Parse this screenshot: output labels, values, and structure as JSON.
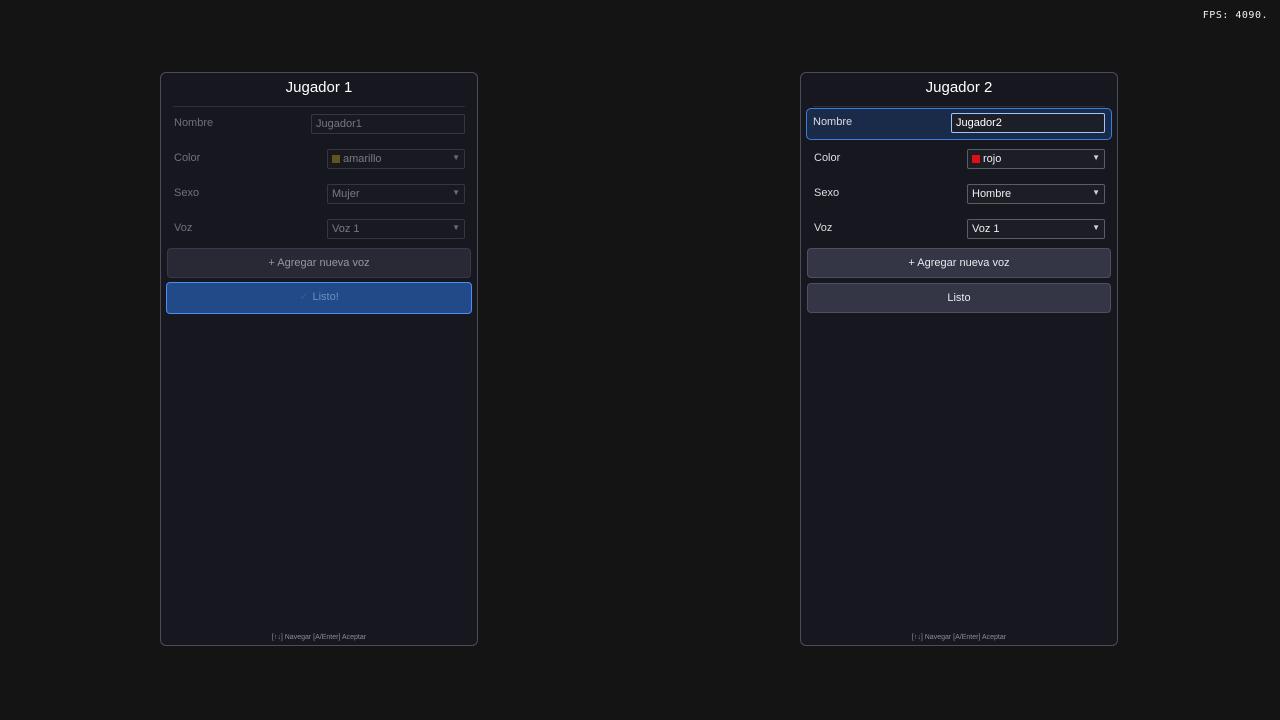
{
  "fps_label": "FPS: 4090.",
  "colors": {
    "background": "#141414",
    "panel": "#16171f",
    "focus_accent": "#3d7fe0",
    "amarillo": "#b8a020",
    "rojo": "#e01010"
  },
  "players": [
    {
      "title": "Jugador 1",
      "nombre_label": "Nombre",
      "nombre_value": "Jugador1",
      "color_label": "Color",
      "color_value": "amarillo",
      "color_swatch": "#b8a020",
      "sexo_label": "Sexo",
      "sexo_value": "Mujer",
      "voz_label": "Voz",
      "voz_value": "Voz 1",
      "add_voice_label": "+ Agregar nueva voz",
      "ready_check_icon": "check-icon",
      "ready_label": "Listo!",
      "hint": "[↑↓] Navegar  [A/Enter] Aceptar"
    },
    {
      "title": "Jugador 2",
      "nombre_label": "Nombre",
      "nombre_value": "Jugador2",
      "color_label": "Color",
      "color_value": "rojo",
      "color_swatch": "#e01010",
      "sexo_label": "Sexo",
      "sexo_value": "Hombre",
      "voz_label": "Voz",
      "voz_value": "Voz 1",
      "add_voice_label": "+ Agregar nueva voz",
      "ready_label": "Listo",
      "hint": "[↑↓] Navegar  [A/Enter] Aceptar"
    }
  ]
}
